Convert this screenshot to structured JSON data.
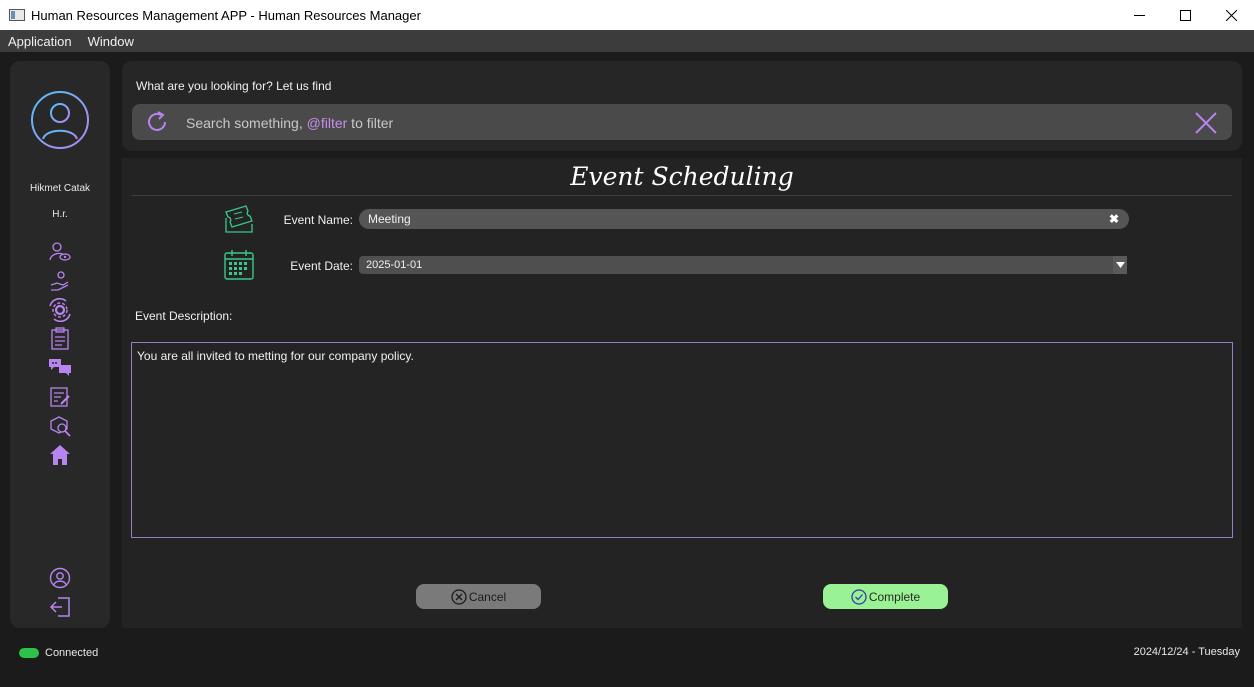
{
  "window": {
    "title": "Human Resources Management APP - Human Resources Manager"
  },
  "menu": [
    "Application",
    "Window"
  ],
  "sidebar": {
    "user_name": "Hikmet Catak",
    "user_role": "H.r.",
    "nav_icons": [
      "user-eye-icon",
      "hand-user-icon",
      "gear-sync-icon",
      "clipboard-icon",
      "chat-icon",
      "form-edit-icon",
      "search-box-icon",
      "home-icon"
    ],
    "bottom_icons": [
      "profile-icon",
      "logout-icon"
    ],
    "accent": "#b784f0"
  },
  "search": {
    "label": "What are you looking for? Let us find",
    "placeholder_prefix": "Search something, ",
    "placeholder_highlight": "@filter",
    "placeholder_suffix": " to filter"
  },
  "form": {
    "heading": "Event Scheduling",
    "event_name_label": "Event Name:",
    "event_name_value": "Meeting",
    "event_date_label": "Event Date:",
    "event_date_value": "2025-01-01",
    "description_label": "Event Description:",
    "description_value": "You are all invited to metting for our company policy.",
    "cancel_label": "Cancel",
    "complete_label": "Complete"
  },
  "status": {
    "connection": "Connected",
    "connection_color": "#2ec24a",
    "date": "2024/12/24 - Tuesday"
  }
}
